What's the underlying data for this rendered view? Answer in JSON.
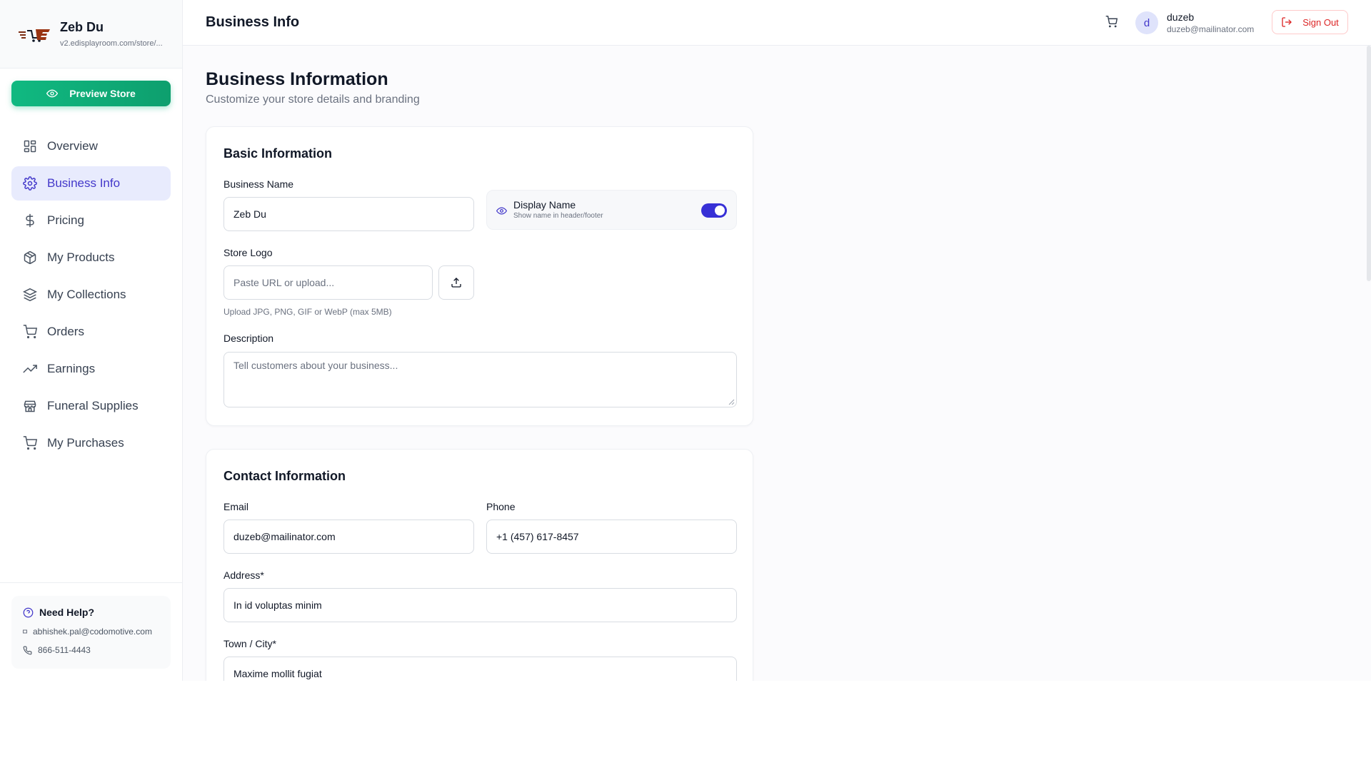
{
  "brand": {
    "name": "Zeb Du",
    "url": "v2.edisplayroom.com/store/..."
  },
  "sidebar": {
    "preview_label": "Preview Store",
    "items": [
      {
        "label": "Overview",
        "icon": "grid-icon"
      },
      {
        "label": "Business Info",
        "icon": "gear-icon",
        "active": true
      },
      {
        "label": "Pricing",
        "icon": "dollar-icon"
      },
      {
        "label": "My Products",
        "icon": "package-icon"
      },
      {
        "label": "My Collections",
        "icon": "layers-icon"
      },
      {
        "label": "Orders",
        "icon": "cart-icon"
      },
      {
        "label": "Earnings",
        "icon": "trending-up-icon"
      },
      {
        "label": "Funeral Supplies",
        "icon": "store-icon"
      },
      {
        "label": "My Purchases",
        "icon": "cart-icon"
      }
    ],
    "help": {
      "title": "Need Help?",
      "email": "abhishek.pal@codomotive.com",
      "phone": "866-511-4443"
    }
  },
  "header": {
    "title": "Business Info",
    "avatar_initial": "d",
    "user_name": "duzeb",
    "user_email": "duzeb@mailinator.com",
    "signout_label": "Sign Out"
  },
  "main": {
    "title": "Business Information",
    "subtitle": "Customize your store details and branding",
    "basic": {
      "title": "Basic Information",
      "business_name_label": "Business Name",
      "business_name_value": "Zeb Du",
      "display_name_title": "Display Name",
      "display_name_sub": "Show name in header/footer",
      "display_name_enabled": true,
      "logo_label": "Store Logo",
      "logo_placeholder": "Paste URL or upload...",
      "logo_hint": "Upload JPG, PNG, GIF or WebP (max 5MB)",
      "description_label": "Description",
      "description_placeholder": "Tell customers about your business..."
    },
    "contact": {
      "title": "Contact Information",
      "email_label": "Email",
      "email_value": "duzeb@mailinator.com",
      "phone_label": "Phone",
      "phone_value": "+1 (457) 617-8457",
      "address_label": "Address*",
      "address_value": "In id voluptas minim",
      "city_label": "Town / City*",
      "city_value": "Maxime mollit fugiat"
    }
  },
  "colors": {
    "accent": "#4338ca",
    "preview_green": "#10b981",
    "signout_red": "#dc2626",
    "toggle_on": "#3730d6"
  }
}
